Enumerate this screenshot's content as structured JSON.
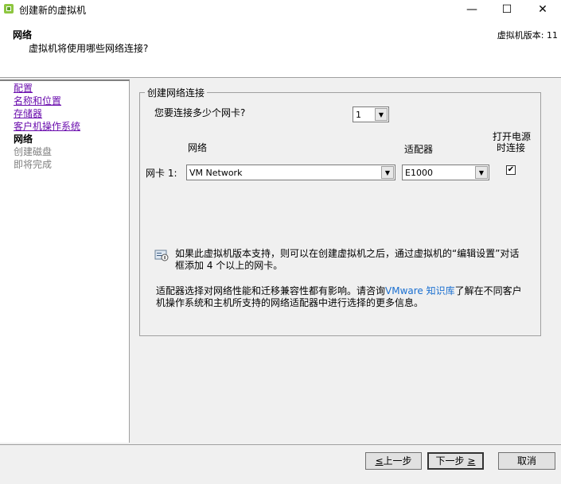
{
  "window": {
    "title": "创建新的虚拟机",
    "minimize": "—",
    "maximize": "☐",
    "close": "✕",
    "icon": "vsphere-logo-icon"
  },
  "header": {
    "title": "网络",
    "subtitle": "虚拟机将使用哪些网络连接?",
    "version": "虚拟机版本: 11"
  },
  "sidebar": {
    "items": [
      {
        "label": "配置",
        "state": "link"
      },
      {
        "label": "名称和位置",
        "state": "link"
      },
      {
        "label": "存储器",
        "state": "link"
      },
      {
        "label": "客户机操作系统",
        "state": "link"
      },
      {
        "label": "网络",
        "state": "current"
      },
      {
        "label": "创建磁盘",
        "state": "disabled"
      },
      {
        "label": "即将完成",
        "state": "disabled"
      }
    ]
  },
  "network": {
    "group_title": "创建网络连接",
    "nic_count_question": "您要连接多少个网卡?",
    "nic_count_value": "1",
    "col_network": "网络",
    "col_adapter": "适配器",
    "col_connect_line1": "打开电源",
    "col_connect_line2": "时连接",
    "nic1_label": "网卡 1:",
    "nic1_network": "VM Network",
    "nic1_adapter": "E1000",
    "nic1_connect_checked": true,
    "check_mark": "✔",
    "info_text": "如果此虚拟机版本支持，则可以在创建虚拟机之后，通过虚拟机的“编辑设置”对话框添加 4 个以上的网卡。",
    "adapter_text_before": "适配器选择对网络性能和迁移兼容性都有影响。请咨询",
    "adapter_link": "VMware 知识库",
    "adapter_text_after": "了解在不同客户机操作系统和主机所支持的网络适配器中进行选择的更多信息。"
  },
  "footer": {
    "back_prefix": "≤",
    "back_label": "上一步",
    "next_label": "下一步",
    "next_suffix": "≥",
    "cancel_label": "取消"
  },
  "colors": {
    "link_visited": "#6a0dad",
    "kb_link": "#1a6fd0",
    "window_bg": "#f0f0f0"
  }
}
